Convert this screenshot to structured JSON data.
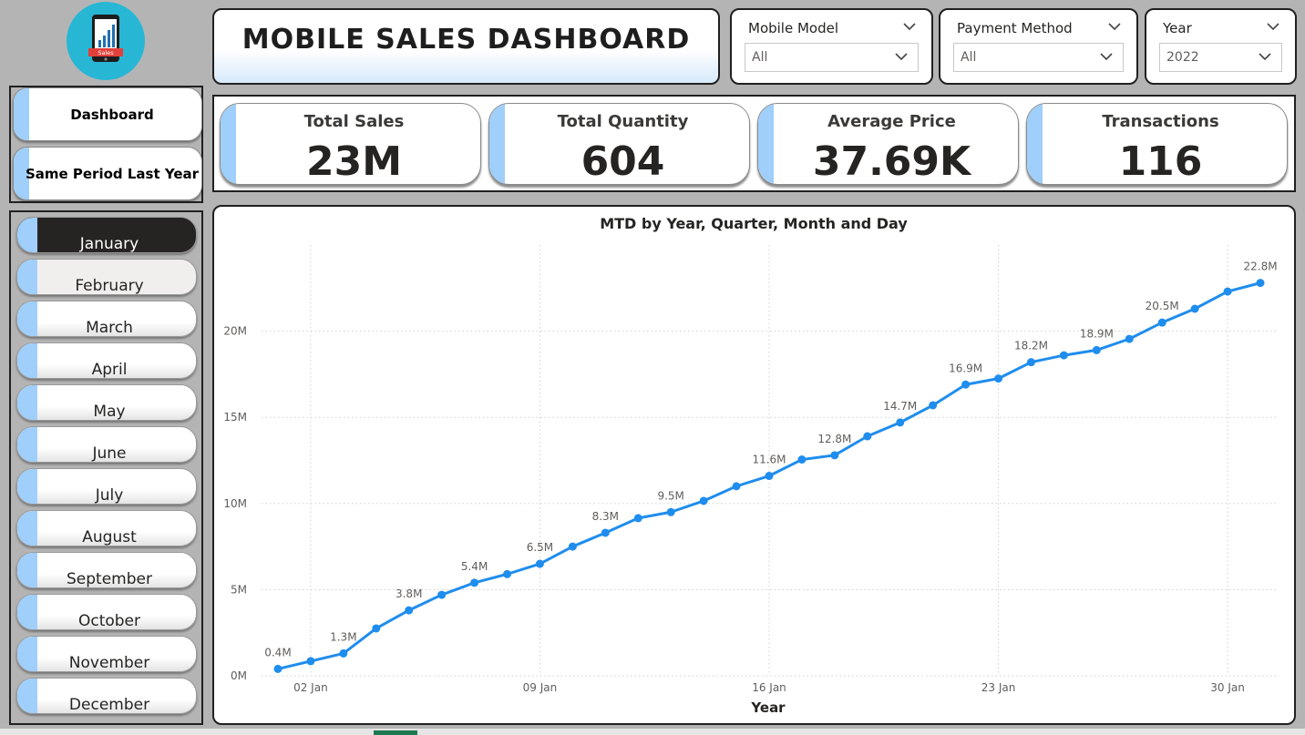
{
  "logo": {
    "badge_text": "Sales",
    "icon": "phone-chart-icon"
  },
  "nav": {
    "items": [
      {
        "label": "Dashboard"
      },
      {
        "label": "Same Period Last Year"
      }
    ]
  },
  "months": {
    "items": [
      {
        "label": "January",
        "state": "active"
      },
      {
        "label": "February",
        "state": "hover"
      },
      {
        "label": "March"
      },
      {
        "label": "April"
      },
      {
        "label": "May"
      },
      {
        "label": "June"
      },
      {
        "label": "July"
      },
      {
        "label": "August"
      },
      {
        "label": "September"
      },
      {
        "label": "October"
      },
      {
        "label": "November"
      },
      {
        "label": "December"
      }
    ]
  },
  "header": {
    "title": "MOBILE SALES DASHBOARD"
  },
  "slicers": [
    {
      "title": "Mobile Model",
      "value": "All"
    },
    {
      "title": "Payment Method",
      "value": "All"
    },
    {
      "title": "Year",
      "value": "2022"
    }
  ],
  "kpis": [
    {
      "label": "Total Sales",
      "value": "23M"
    },
    {
      "label": "Total Quantity",
      "value": "604"
    },
    {
      "label": "Average Price",
      "value": "37.69K"
    },
    {
      "label": "Transactions",
      "value": "116"
    }
  ],
  "colors": {
    "accent": "#9fcffa",
    "line": "#1f8ded",
    "active": "#252423"
  },
  "chart_data": {
    "type": "line",
    "title": "MTD by Year, Quarter, Month and Day",
    "xlabel": "Year",
    "ylabel": "",
    "ylim": [
      0,
      25
    ],
    "xlim": [
      0.5,
      31.5
    ],
    "y_ticks": [
      {
        "v": 0,
        "label": "0M"
      },
      {
        "v": 5,
        "label": "5M"
      },
      {
        "v": 10,
        "label": "10M"
      },
      {
        "v": 15,
        "label": "15M"
      },
      {
        "v": 20,
        "label": "20M"
      }
    ],
    "x_ticks": [
      {
        "v": 2,
        "label": "02 Jan"
      },
      {
        "v": 9,
        "label": "09 Jan"
      },
      {
        "v": 16,
        "label": "16 Jan"
      },
      {
        "v": 23,
        "label": "23 Jan"
      },
      {
        "v": 30,
        "label": "30 Jan"
      }
    ],
    "grid": true,
    "series": [
      {
        "x": [
          1,
          2,
          3,
          4,
          5,
          6,
          7,
          8,
          9,
          10,
          11,
          12,
          13,
          14,
          15,
          16,
          17,
          18,
          19,
          20,
          21,
          22,
          23,
          24,
          25,
          26,
          27,
          28,
          29,
          30,
          31
        ],
        "values": [
          0.4,
          0.85,
          1.3,
          2.75,
          3.8,
          4.7,
          5.4,
          5.9,
          6.5,
          7.5,
          8.3,
          9.15,
          9.5,
          10.15,
          11.0,
          11.6,
          12.55,
          12.8,
          13.9,
          14.7,
          15.7,
          16.9,
          17.25,
          18.2,
          18.6,
          18.9,
          19.55,
          20.5,
          21.3,
          22.3,
          22.8
        ],
        "data_labels": [
          {
            "i": 0,
            "text": "0.4M"
          },
          {
            "i": 2,
            "text": "1.3M"
          },
          {
            "i": 4,
            "text": "3.8M"
          },
          {
            "i": 6,
            "text": "5.4M"
          },
          {
            "i": 8,
            "text": "6.5M"
          },
          {
            "i": 10,
            "text": "8.3M"
          },
          {
            "i": 12,
            "text": "9.5M"
          },
          {
            "i": 15,
            "text": "11.6M"
          },
          {
            "i": 17,
            "text": "12.8M"
          },
          {
            "i": 19,
            "text": "14.7M"
          },
          {
            "i": 21,
            "text": "16.9M"
          },
          {
            "i": 23,
            "text": "18.2M"
          },
          {
            "i": 25,
            "text": "18.9M"
          },
          {
            "i": 27,
            "text": "20.5M"
          },
          {
            "i": 30,
            "text": "22.8M"
          }
        ]
      }
    ]
  }
}
